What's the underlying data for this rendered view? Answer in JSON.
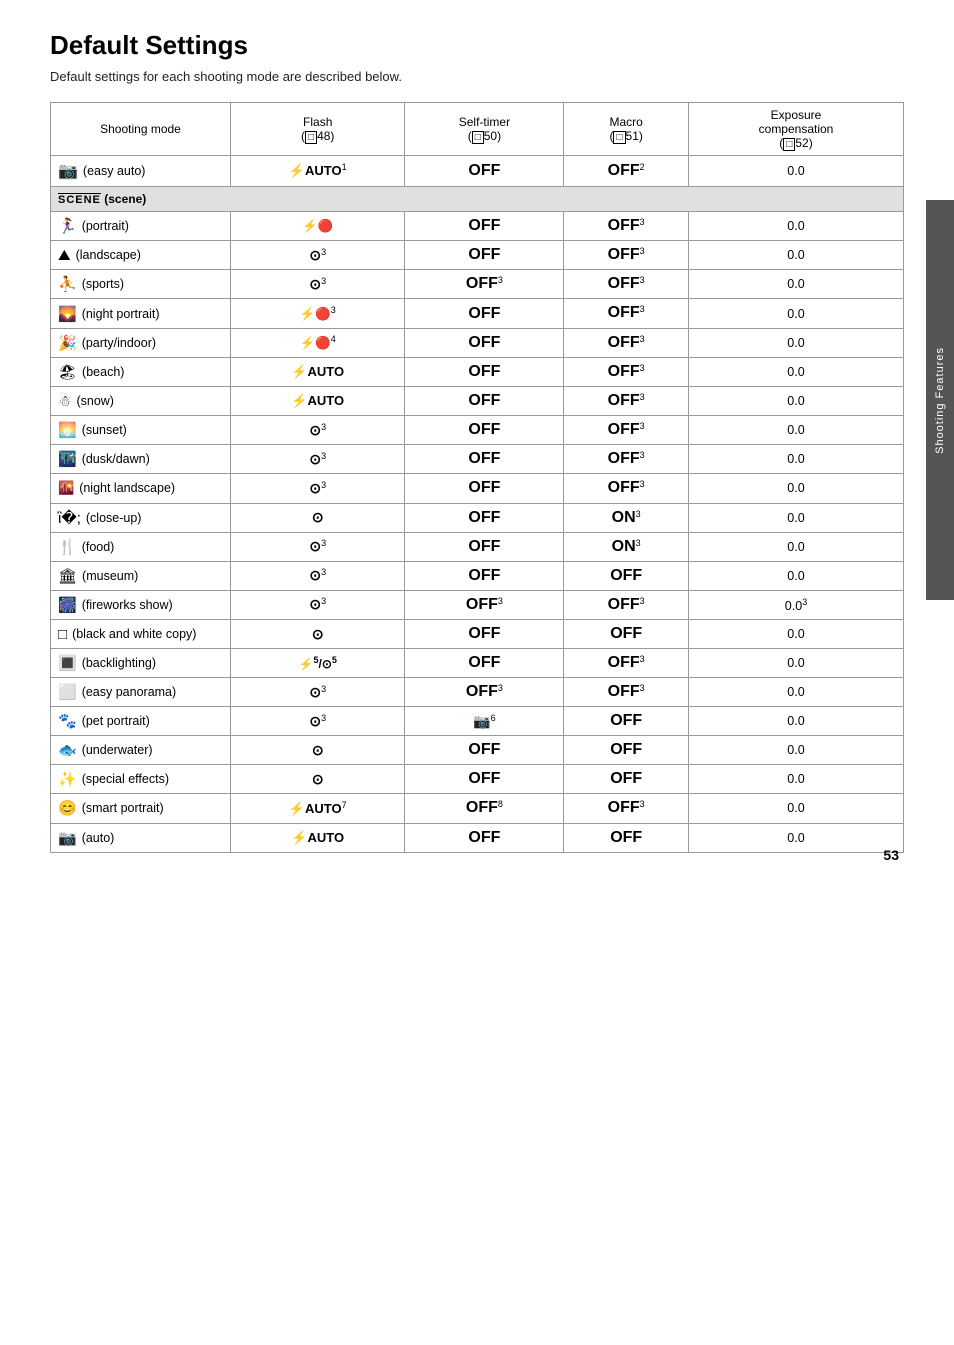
{
  "page": {
    "title": "Default Settings",
    "subtitle": "Default settings for each shooting mode are described below.",
    "page_number": "53",
    "sidebar_label": "Shooting Features"
  },
  "table": {
    "headers": [
      "Shooting mode",
      "Flash\n(□48)",
      "Self-timer\n(□50)",
      "Macro\n(□51)",
      "Exposure\ncompensation\n(□52)"
    ],
    "rows": [
      {
        "mode_icon": "📷",
        "mode_label": "(easy auto)",
        "flash": "⚡AUTO¹",
        "self_timer": "OFF",
        "macro": "OFF²",
        "exposure": "0.0"
      },
      {
        "mode_icon": "SCENE",
        "mode_label": "(scene)",
        "flash": "",
        "self_timer": "",
        "macro": "",
        "exposure": "",
        "is_section": true
      },
      {
        "mode_icon": "🤳",
        "mode_label": "(portrait)",
        "flash": "⚡🔴",
        "self_timer": "OFF",
        "macro": "OFF³",
        "exposure": "0.0"
      },
      {
        "mode_icon": "🏔",
        "mode_label": "(landscape)",
        "flash": "🚫³",
        "self_timer": "OFF",
        "macro": "OFF³",
        "exposure": "0.0"
      },
      {
        "mode_icon": "🏃",
        "mode_label": "(sports)",
        "flash": "🚫³",
        "self_timer": "OFF³",
        "macro": "OFF³",
        "exposure": "0.0"
      },
      {
        "mode_icon": "🌃",
        "mode_label": "(night portrait)",
        "flash": "⚡🔴³",
        "self_timer": "OFF",
        "macro": "OFF³",
        "exposure": "0.0"
      },
      {
        "mode_icon": "🎉",
        "mode_label": "(party/indoor)",
        "flash": "⚡🔴⁴",
        "self_timer": "OFF",
        "macro": "OFF³",
        "exposure": "0.0"
      },
      {
        "mode_icon": "🏖",
        "mode_label": "(beach)",
        "flash": "⚡AUTO",
        "self_timer": "OFF",
        "macro": "OFF³",
        "exposure": "0.0"
      },
      {
        "mode_icon": "❄",
        "mode_label": "(snow)",
        "flash": "⚡AUTO",
        "self_timer": "OFF",
        "macro": "OFF³",
        "exposure": "0.0"
      },
      {
        "mode_icon": "🌅",
        "mode_label": "(sunset)",
        "flash": "🚫³",
        "self_timer": "OFF",
        "macro": "OFF³",
        "exposure": "0.0"
      },
      {
        "mode_icon": "🌄",
        "mode_label": "(dusk/dawn)",
        "flash": "🚫³",
        "self_timer": "OFF",
        "macro": "OFF³",
        "exposure": "0.0"
      },
      {
        "mode_icon": "🌉",
        "mode_label": "(night landscape)",
        "flash": "🚫³",
        "self_timer": "OFF",
        "macro": "OFF³",
        "exposure": "0.0"
      },
      {
        "mode_icon": "🌸",
        "mode_label": "(close-up)",
        "flash": "🚫",
        "self_timer": "OFF",
        "macro": "ON³",
        "exposure": "0.0"
      },
      {
        "mode_icon": "🍽",
        "mode_label": "(food)",
        "flash": "🚫³",
        "self_timer": "OFF",
        "macro": "ON³",
        "exposure": "0.0"
      },
      {
        "mode_icon": "🏛",
        "mode_label": "(museum)",
        "flash": "🚫³",
        "self_timer": "OFF",
        "macro": "OFF",
        "exposure": "0.0"
      },
      {
        "mode_icon": "🎆",
        "mode_label": "(fireworks show)",
        "flash": "🚫³",
        "self_timer": "OFF³",
        "macro": "OFF³",
        "exposure": "0.0³"
      },
      {
        "mode_icon": "⬜",
        "mode_label": "(black and white copy)",
        "flash": "🚫",
        "self_timer": "OFF",
        "macro": "OFF",
        "exposure": "0.0"
      },
      {
        "mode_icon": "💡",
        "mode_label": "(backlighting)",
        "flash": "⚡⁵/🚫⁵",
        "self_timer": "OFF",
        "macro": "OFF³",
        "exposure": "0.0"
      },
      {
        "mode_icon": "⊟",
        "mode_label": "(easy panorama)",
        "flash": "🚫³",
        "self_timer": "OFF³",
        "macro": "OFF³",
        "exposure": "0.0"
      },
      {
        "mode_icon": "🐾",
        "mode_label": "(pet portrait)",
        "flash": "🚫³",
        "self_timer": "📷⁶",
        "macro": "OFF",
        "exposure": "0.0"
      },
      {
        "mode_icon": "🌊",
        "mode_label": "(underwater)",
        "flash": "🚫",
        "self_timer": "OFF",
        "macro": "OFF",
        "exposure": "0.0"
      },
      {
        "mode_icon": "✨",
        "mode_label": "(special effects)",
        "flash": "🚫",
        "self_timer": "OFF",
        "macro": "OFF",
        "exposure": "0.0"
      },
      {
        "mode_icon": "😊",
        "mode_label": "(smart portrait)",
        "flash": "⚡AUTO⁷",
        "self_timer": "OFF⁸",
        "macro": "OFF³",
        "exposure": "0.0"
      },
      {
        "mode_icon": "📷",
        "mode_label": "(auto)",
        "flash": "⚡AUTO",
        "self_timer": "OFF",
        "macro": "OFF",
        "exposure": "0.0"
      }
    ]
  }
}
